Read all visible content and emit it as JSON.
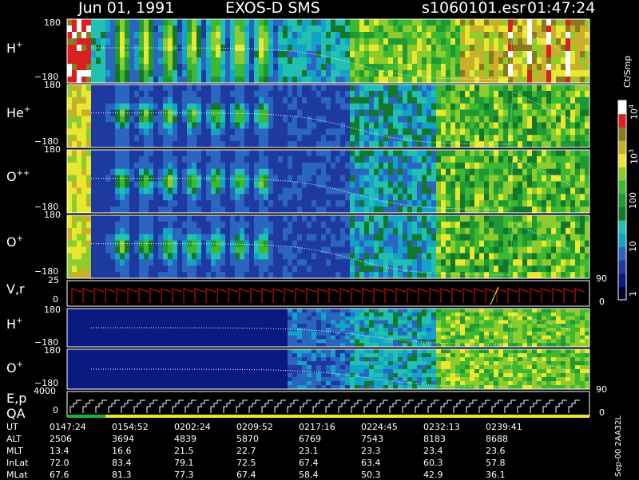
{
  "header": {
    "date": "Jun 01, 1991",
    "instrument": "EXOS-D SMS",
    "file": "s1060101.esr",
    "time": "01:47:24"
  },
  "colors": {
    "background": "#000000",
    "text": "#ffffff",
    "trace": "#ffffff",
    "vr_trace": "#e01010",
    "vr_alt_trace": "#ffff40",
    "qa_good": "#19b23c",
    "qa_ok": "#e8e830",
    "colormap": [
      "#000030",
      "#0a1a80",
      "#1e3aa0",
      "#2a66c0",
      "#13a3c8",
      "#22c0b0",
      "#13782c",
      "#1f9a34",
      "#3cb832",
      "#8ecb2c",
      "#e8e830",
      "#c8b02a",
      "#8c7a20",
      "#d82020",
      "#ffffff"
    ]
  },
  "colorbar": {
    "unit": "Ct/Smp",
    "labels": [
      "10^4",
      "10^3",
      "100",
      "10",
      "1"
    ]
  },
  "side_labels": {
    "vr_right_top": "90",
    "vr_right_bottom": "0",
    "ep_right_top": "90",
    "ep_right_bottom": "0"
  },
  "footer_note": "Sep-00 2AA32L",
  "chart_data": [
    {
      "type": "heatmap",
      "name": "H+",
      "label": "H",
      "sup": "+",
      "ylim": [
        -180,
        180
      ],
      "ytick_labels": [
        "180",
        "−180"
      ]
    },
    {
      "type": "heatmap",
      "name": "He+",
      "label": "He",
      "sup": "+",
      "ylim": [
        -180,
        180
      ],
      "ytick_labels": [
        "180",
        "−180"
      ]
    },
    {
      "type": "heatmap",
      "name": "O++",
      "label": "O",
      "sup": "++",
      "ylim": [
        -180,
        180
      ],
      "ytick_labels": [
        "180",
        "−180"
      ]
    },
    {
      "type": "heatmap",
      "name": "O+",
      "label": "O",
      "sup": "+",
      "ylim": [
        -180,
        180
      ],
      "ytick_labels": [
        "180",
        "−180"
      ]
    },
    {
      "type": "line",
      "name": "V,r",
      "label": "V,r",
      "ylim": [
        0,
        25
      ],
      "ytick_labels": [
        "25",
        "0"
      ]
    },
    {
      "type": "heatmap",
      "name": "H+ (lower)",
      "label": "H",
      "sup": "+",
      "ylim": [
        -180,
        180
      ],
      "ytick_labels": [
        "180",
        "−180"
      ]
    },
    {
      "type": "heatmap",
      "name": "O+ (lower)",
      "label": "O",
      "sup": "+",
      "ylim": [
        -180,
        180
      ],
      "ytick_labels": [
        "180",
        "−180"
      ]
    },
    {
      "type": "line",
      "name": "E,p",
      "label": "E,p",
      "label2": "QA",
      "ylim": [
        0,
        4000
      ],
      "ytick_labels": [
        "4000",
        "0"
      ]
    }
  ],
  "table": {
    "rows": [
      {
        "label": "UT",
        "values": [
          "0147:24",
          "0154:52",
          "0202:24",
          "0209:52",
          "0217:16",
          "0224:45",
          "0232:13",
          "0239:41"
        ]
      },
      {
        "label": "ALT",
        "values": [
          "2506",
          "3694",
          "4839",
          "5870",
          "6769",
          "7543",
          "8183",
          "8688"
        ]
      },
      {
        "label": "MLT",
        "values": [
          "13.4",
          "16.6",
          "21.5",
          "22.7",
          "23.1",
          "23.3",
          "23.4",
          "23.6"
        ]
      },
      {
        "label": "InLat",
        "values": [
          "72.0",
          "83.4",
          "79.1",
          "72.5",
          "67.4",
          "63.4",
          "60.3",
          "57.8"
        ]
      },
      {
        "label": "MLat",
        "values": [
          "67.6",
          "81.3",
          "77.3",
          "67.4",
          "58.4",
          "50.3",
          "42.9",
          "36.1"
        ]
      }
    ]
  }
}
